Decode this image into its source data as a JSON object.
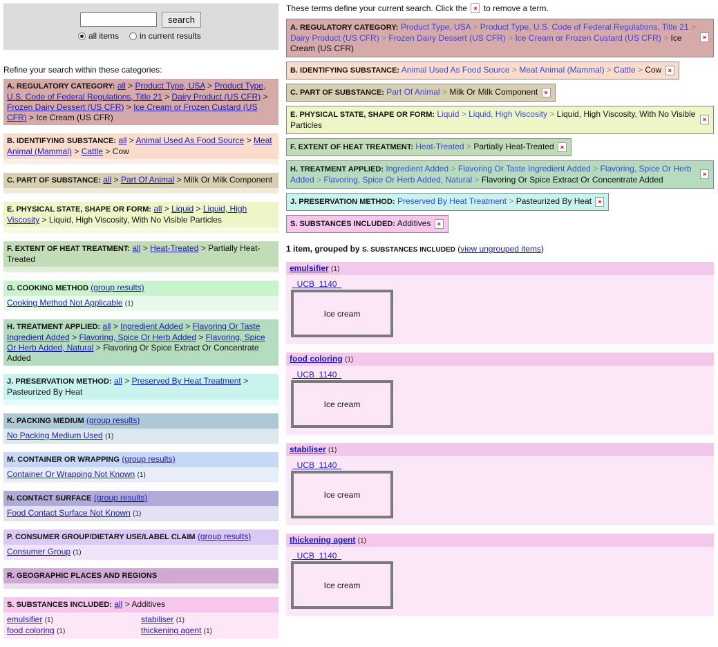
{
  "search": {
    "button": "search",
    "value": "",
    "opt_all": "all items",
    "opt_current": "in current results"
  },
  "refine_label": "Refine your search within these categories:",
  "left": {
    "A": {
      "label": "A. REGULATORY CATEGORY",
      "all": "all",
      "path": [
        "Product Type, USA",
        "Product Type, U.S. Code of Federal Regulations, Title 21",
        "Dairy Product (US CFR)",
        "Frozen Dairy Dessert (US CFR)",
        "Ice Cream or Frozen Custard (US CFR)"
      ],
      "current": "Ice Cream (US CFR)"
    },
    "B": {
      "label": "B. IDENTIFYING SUBSTANCE",
      "all": "all",
      "path": [
        "Animal Used As Food Source",
        "Meat Animal (Mammal)",
        "Cattle"
      ],
      "current": "Cow"
    },
    "C": {
      "label": "C. PART OF SUBSTANCE",
      "all": "all",
      "path": [
        "Part Of Animal"
      ],
      "current": "Milk Or Milk Component"
    },
    "E": {
      "label": "E. PHYSICAL STATE, SHAPE OR FORM",
      "all": "all",
      "path": [
        "Liquid",
        "Liquid, High Viscosity"
      ],
      "current": "Liquid, High Viscosity, With No Visible Particles"
    },
    "F": {
      "label": "F. EXTENT OF HEAT TREATMENT",
      "all": "all",
      "path": [
        "Heat-Treated"
      ],
      "current": "Partially Heat-Treated"
    },
    "G": {
      "label": "G. COOKING METHOD",
      "group": "(group results)",
      "items": [
        {
          "name": "Cooking Method Not Applicable",
          "count": "(1)"
        }
      ]
    },
    "H": {
      "label": "H. TREATMENT APPLIED",
      "all": "all",
      "path": [
        "Ingredient Added",
        "Flavoring Or Taste Ingredient Added",
        "Flavoring, Spice Or Herb Added",
        "Flavoring, Spice Or Herb Added, Natural"
      ],
      "current": "Flavoring Or Spice Extract Or Concentrate Added"
    },
    "J": {
      "label": "J. PRESERVATION METHOD",
      "all": "all",
      "path": [
        "Preserved By Heat Treatment"
      ],
      "current": "Pasteurized By Heat"
    },
    "K": {
      "label": "K. PACKING MEDIUM",
      "group": "(group results)",
      "items": [
        {
          "name": "No Packing Medium Used",
          "count": "(1)"
        }
      ]
    },
    "M": {
      "label": "M. CONTAINER OR WRAPPING",
      "group": "(group results)",
      "items": [
        {
          "name": "Container Or Wrapping Not Known",
          "count": "(1)"
        }
      ]
    },
    "N": {
      "label": "N. CONTACT SURFACE",
      "group": "(group results)",
      "items": [
        {
          "name": "Food Contact Surface Not Known",
          "count": "(1)"
        }
      ]
    },
    "P": {
      "label": "P. CONSUMER GROUP/DIETARY USE/LABEL CLAIM",
      "group": "(group results)",
      "items": [
        {
          "name": "Consumer Group",
          "count": "(1)"
        }
      ]
    },
    "R": {
      "label": "R. GEOGRAPHIC PLACES AND REGIONS"
    },
    "S": {
      "label": "S. SUBSTANCES INCLUDED",
      "all": "all",
      "current": "Additives",
      "items": [
        {
          "name": "emulsifier",
          "count": "(1)"
        },
        {
          "name": "stabiliser",
          "count": "(1)"
        },
        {
          "name": "food coloring",
          "count": "(1)"
        },
        {
          "name": "thickening agent",
          "count": "(1)"
        }
      ]
    }
  },
  "right": {
    "intro_before": "These terms define your current search. Click the",
    "intro_after": "to remove a term.",
    "x": "×",
    "summary_count": "1 item, grouped by",
    "summary_by": "S. SUBSTANCES INCLUDED",
    "summary_link": "view ungrouped items",
    "record_link": "  UCB  1140  ",
    "record_title": "Ice cream",
    "groups": [
      {
        "name": "emulsifier",
        "count": "(1)"
      },
      {
        "name": "food coloring",
        "count": "(1)"
      },
      {
        "name": "stabiliser",
        "count": "(1)"
      },
      {
        "name": "thickening agent",
        "count": "(1)"
      }
    ]
  },
  "colors": {
    "A": "#d7aaaa",
    "B": "#f9dccb",
    "C": "#d8ceb1",
    "E": "#eef5c6",
    "F": "#c2dcb7",
    "G_h": "#c9f3cd",
    "G_b": "#e9f9eb",
    "H": "#b5dcbf",
    "J": "#c9f3ef",
    "K_h": "#adc8d6",
    "K_b": "#dde8ee",
    "M_h": "#c6d8f5",
    "M_b": "#e7eefa",
    "N_h": "#b0abd9",
    "N_b": "#e3e1f2",
    "P_h": "#dbc8f4",
    "P_b": "#eee5f9",
    "R_h": "#d0a9d4",
    "S_h": "#f6c6ec",
    "S_b": "#fce6f8"
  }
}
